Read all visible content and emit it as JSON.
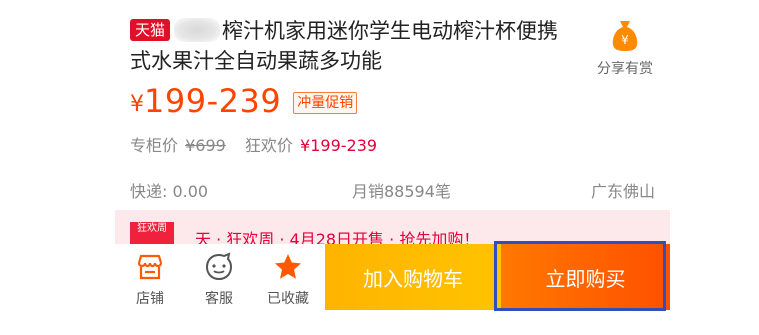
{
  "product": {
    "badge": "天猫",
    "title": "榨汁机家用迷你学生电动榨汁杯便携式水果汁全自动果蔬多功能"
  },
  "share": {
    "label": "分享有赏",
    "icon": "money-bag-icon"
  },
  "price": {
    "currency": "¥",
    "range": "199-239",
    "promo_tag": "冲量促销"
  },
  "sub_price": {
    "counter_label": "专柜价",
    "counter_value": "¥699",
    "festival_label": "狂欢价",
    "festival_value": "¥199-239"
  },
  "info": {
    "shipping": "快递: 0.00",
    "monthly_sales": "月销88594笔",
    "location": "广东佛山"
  },
  "event": {
    "logo_text": "狂欢周",
    "text": "天 · 狂欢周 · 4月28日开售 · 抢先加购！"
  },
  "bottom_bar": {
    "store": "店铺",
    "service": "客服",
    "favorited": "已收藏",
    "add_to_cart": "加入购物车",
    "buy_now": "立即购买"
  },
  "colors": {
    "accent": "#ff4400",
    "tmall_red": "#e0102a",
    "cart_yellow": "#ffc300",
    "buy_orange": "#ff5000",
    "highlight_blue": "#2f4fbe"
  }
}
